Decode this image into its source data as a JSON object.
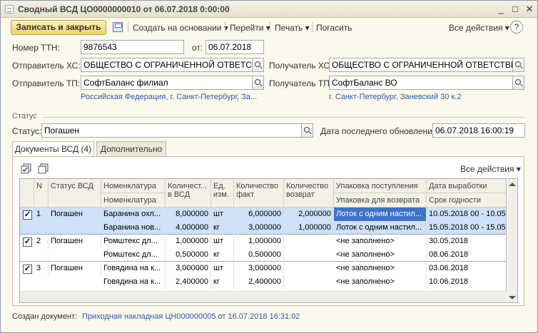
{
  "window": {
    "title": "Сводный ВСД ЦО0000000010 от 06.07.2018 0:00:00",
    "minimize": "_",
    "maximize": "□",
    "close": "✕"
  },
  "toolbar": {
    "save_close": "Записать и закрыть",
    "create_based": "Создать на основании",
    "goto": "Перейти",
    "print": "Печать",
    "redeem": "Погасить",
    "all_actions": "Все действия",
    "help": "?"
  },
  "form": {
    "ttn_label": "Номер ТТН:",
    "ttn_value": "9876543",
    "from_label": "от:",
    "from_value": "06.07.2018",
    "sender_hs_label": "Отправитель ХС:",
    "sender_hs_value": "ОБЩЕСТВО С ОГРАНИЧЕННОЙ ОТВЕТСТВЕННОСТЬЮ",
    "receiver_hs_label": "Получатель ХС:",
    "receiver_hs_value": "ОБЩЕСТВО С ОГРАНИЧЕННОЙ ОТВЕТСТВЕННОСТЬЮ",
    "sender_tp_label": "Отправитель ТП:",
    "sender_tp_value": "СофтБаланс филиал",
    "receiver_tp_label": "Получатель ТП:",
    "receiver_tp_value": "СофтБаланс ВО",
    "sender_address": "Российская Федерация, г. Санкт-Петербург, За...",
    "receiver_address": "г. Санкт-Петербург, Заневский 30 к.2"
  },
  "status": {
    "section": "Статус",
    "label": "Статус:",
    "value": "Погашен",
    "updated_label": "Дата последнего обновления:",
    "updated_value": "06.07.2018 16:00:19"
  },
  "tabs": [
    {
      "label": "Документы ВСД (4)"
    },
    {
      "label": "Дополнительно"
    }
  ],
  "table": {
    "all_actions": "Все действия",
    "headers": {
      "n": "N",
      "status": "Статус ВСД",
      "nomenclature": "Номенклатура",
      "nomenclature2": "Номенклатура",
      "qty_vsd": "Количест... в ВСД",
      "unit": "Ед. изм.",
      "qty_fact": "Количество факт",
      "qty_return": "Количество возврат",
      "pack_in": "Упаковка поступления",
      "pack_return": "Упаковка для возврата",
      "prod_date": "Дата выработки",
      "expiry": "Срок годности"
    },
    "rows": [
      {
        "n": "1",
        "status": "Погашен",
        "checked": "✓",
        "lines": [
          {
            "nom": "Баранина охл...",
            "qty": "8,000000",
            "unit": "шт",
            "fact": "6,000000",
            "ret": "2,000000",
            "pack": "Лоток с одним настил...",
            "date": "10.05.2018 00 - 10.05"
          },
          {
            "nom": "Баранина нов...",
            "qty": "4,000000",
            "unit": "кг",
            "fact": "3,000000",
            "ret": "1,000000",
            "pack": "Лоток с одним настил...",
            "date": "15.05.2018 00 - 15.05"
          }
        ]
      },
      {
        "n": "2",
        "status": "Погашен",
        "checked": "✓",
        "lines": [
          {
            "nom": "Ромштекс дл...",
            "qty": "1,000000",
            "unit": "шт",
            "fact": "1,000000",
            "ret": "",
            "pack": "<не заполнено>",
            "date": "30.05.2018"
          },
          {
            "nom": "Ромштекс дл...",
            "qty": "0,500000",
            "unit": "кг",
            "fact": "0,500000",
            "ret": "",
            "pack": "<не заполнено>",
            "date": "08.06.2018"
          }
        ]
      },
      {
        "n": "3",
        "status": "Погашен",
        "checked": "✓",
        "lines": [
          {
            "nom": "Говядина на к...",
            "qty": "3,000000",
            "unit": "шт",
            "fact": "3,000000",
            "ret": "",
            "pack": "<не заполнено>",
            "date": "03.06.2018"
          },
          {
            "nom": "Говядина на к...",
            "qty": "2,400000",
            "unit": "кг",
            "fact": "2,400000",
            "ret": "",
            "pack": "<не заполнено>",
            "date": "10.06.2018"
          }
        ]
      }
    ]
  },
  "footer": {
    "label": "Создан документ:",
    "link": "Приходная накладная ЦН000000005 от 16.07.2018 16:31:02"
  }
}
